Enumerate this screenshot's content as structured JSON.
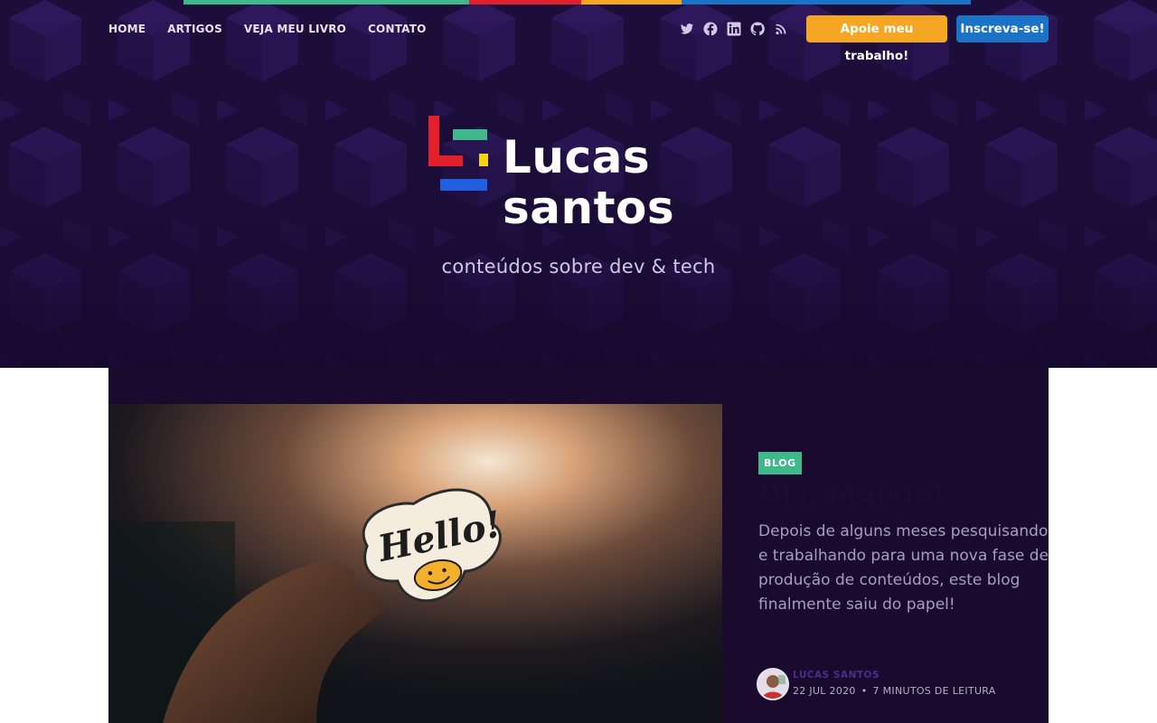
{
  "colors": {
    "hero_bg": "#20103f",
    "card_bg": "#1a0a2e",
    "stripe": [
      "#3fb88b",
      "#e0202b",
      "#f5a623",
      "#1a73c7"
    ],
    "support_btn": "#f5a623",
    "subscribe_btn": "#1a73c7",
    "tag_bg": "#3fb88b"
  },
  "nav": {
    "items": [
      {
        "label": "HOME"
      },
      {
        "label": "ARTIGOS"
      },
      {
        "label": "VEJA MEU LIVRO"
      },
      {
        "label": "CONTATO"
      }
    ]
  },
  "social": {
    "icons": [
      "twitter-icon",
      "facebook-icon",
      "linkedin-icon",
      "github-icon",
      "rss-icon"
    ]
  },
  "header": {
    "support_label": "Apoie meu trabalho!",
    "subscribe_label": "Inscreva-se!"
  },
  "logo": {
    "line1": "Lucas",
    "line2": "santos"
  },
  "hero": {
    "tagline": "conteúdos sobre dev & tech"
  },
  "post": {
    "tag": "BLOG",
    "title": "Olá, Mundo!",
    "excerpt": "Depois de alguns meses pesquisando e trabalhando para uma nova fase de produção de conteúdos, este blog finalmente saiu do papel!",
    "image_sticker_text": "Hello!",
    "author": "LUCAS SANTOS",
    "date": "22 JUL 2020",
    "read_time": "7 MINUTOS DE LEITURA"
  }
}
